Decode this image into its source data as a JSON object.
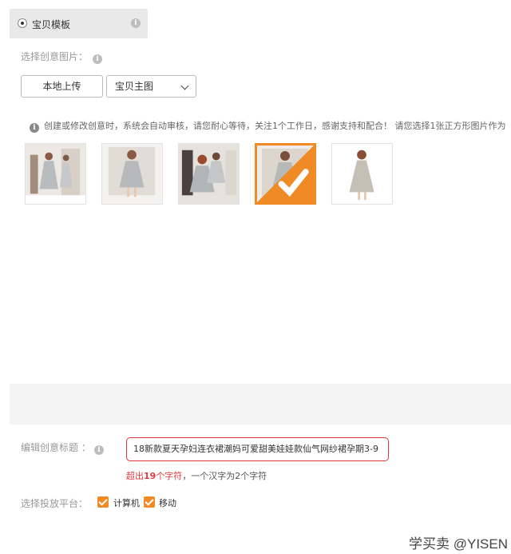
{
  "template_tab": {
    "label": "宝贝模板",
    "info_icon": "info-icon"
  },
  "image_section": {
    "label": "选择创意图片：",
    "upload_button": "本地上传",
    "source_select": {
      "selected": "宝贝主图"
    }
  },
  "notice": "创建或修改创意时，系统会自动审核，请您耐心等待，关注1个工作日，感谢支持和配合！ 请您选择1张正方形图片作为",
  "thumbnails": [
    {
      "selected": false
    },
    {
      "selected": false
    },
    {
      "selected": false
    },
    {
      "selected": true
    },
    {
      "selected": false
    }
  ],
  "title_section": {
    "label": "编辑创意标题 ：",
    "value": "18新款夏天孕妇连衣裙潮妈可爱甜美娃娃款仙气网纱裙孕期3-9",
    "warning_prefix": "超出",
    "warning_count": "19",
    "warning_unit": "个字符",
    "warning_suffix": "，一个汉字为2个字符"
  },
  "platform_section": {
    "label": "选择投放平台：",
    "options": [
      {
        "label": "计算机",
        "checked": true
      },
      {
        "label": "移动",
        "checked": true
      }
    ]
  },
  "watermark": "学买卖 @YISEN",
  "colors": {
    "accent": "#f08a24",
    "error": "#e0393e"
  }
}
